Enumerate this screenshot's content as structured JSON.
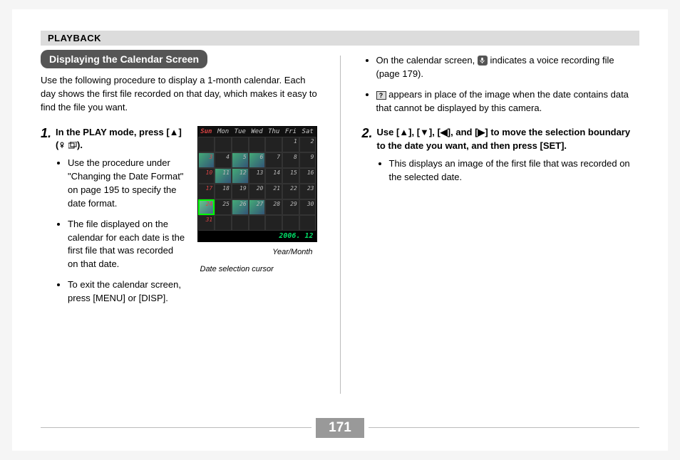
{
  "header": "PLAYBACK",
  "section_title": "Displaying the Calendar Screen",
  "intro": "Use the following procedure to display a 1-month calendar. Each day shows the first file recorded on that day, which makes it easy to find the file you want.",
  "step1": {
    "num": "1.",
    "text_a": "In the PLAY mode, press [",
    "text_b": "] (",
    "text_c": ").",
    "bullets": [
      "Use the procedure under \"Changing the Date Format\" on page 195 to specify the date format.",
      "The file displayed on the calendar for each date is the first file that was recorded on that date.",
      "To exit the calendar screen, press [MENU] or [DISP]."
    ]
  },
  "figure": {
    "days": [
      "Sun",
      "Mon",
      "Tue",
      "Wed",
      "Thu",
      "Fri",
      "Sat"
    ],
    "year_month": "2006. 12",
    "label_year": "Year/Month",
    "label_cursor": "Date selection cursor"
  },
  "right_bullets": {
    "b1_a": "On the calendar screen, ",
    "b1_b": " indicates a voice recording file (page 179).",
    "b2_a": "",
    "b2_b": " appears in place of the image when the date contains data that cannot be displayed by this camera."
  },
  "step2": {
    "num": "2.",
    "text": "Use [▲], [▼], [◀], and [▶] to move the selection boundary to the date you want, and then press [SET].",
    "bullets": [
      "This displays an image of the first file that was recorded on the selected date."
    ]
  },
  "page_number": "171"
}
